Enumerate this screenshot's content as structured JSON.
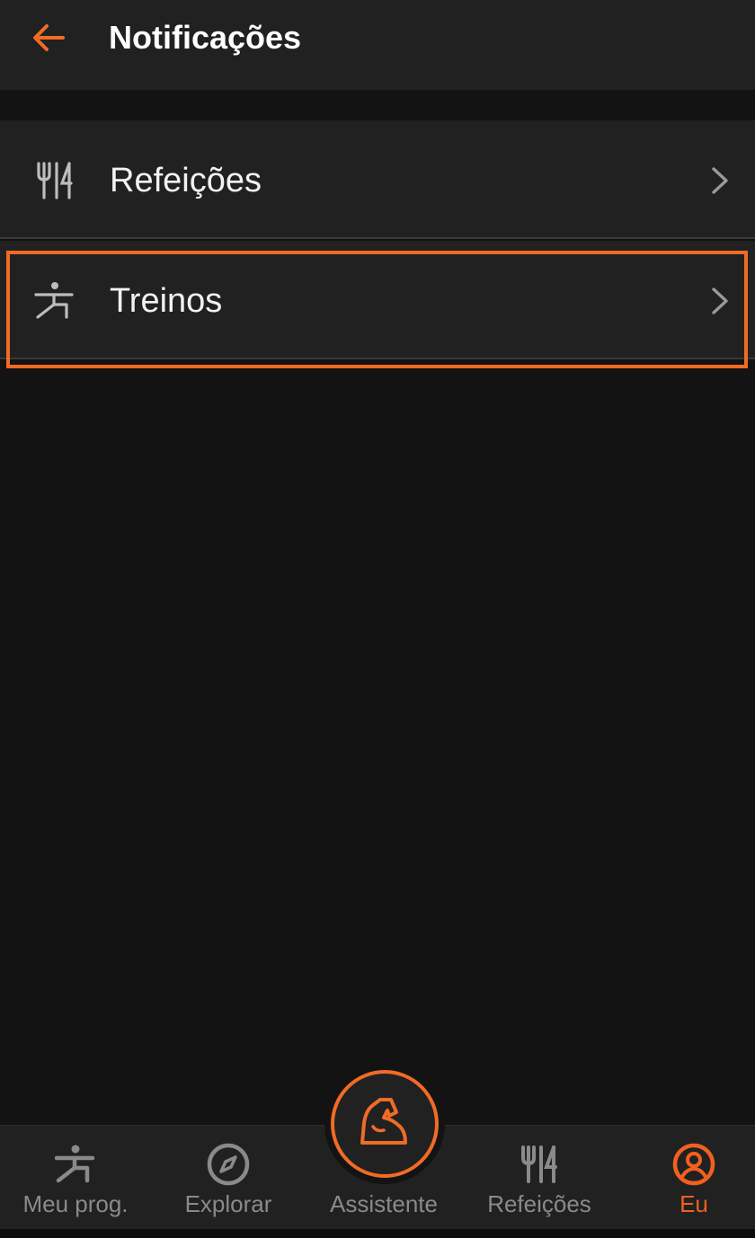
{
  "header": {
    "title": "Notificações",
    "back_icon": "arrow-left-icon"
  },
  "menu": {
    "items": [
      {
        "label": "Refeições",
        "icon": "fork-knife-icon"
      },
      {
        "label": "Treinos",
        "icon": "exercise-icon"
      }
    ]
  },
  "bottom_nav": {
    "items": [
      {
        "label": "Meu prog.",
        "icon": "exercise-icon"
      },
      {
        "label": "Explorar",
        "icon": "compass-icon"
      },
      {
        "label": "Assistente",
        "icon": "muscle-arm-icon"
      },
      {
        "label": "Refeições",
        "icon": "fork-knife-icon"
      },
      {
        "label": "Eu",
        "icon": "profile-icon",
        "active": true
      }
    ]
  },
  "colors": {
    "accent": "#f06b26",
    "background": "#131313",
    "surface": "#212121",
    "text_primary": "#ffffff",
    "text_muted": "#8a8a8a"
  }
}
